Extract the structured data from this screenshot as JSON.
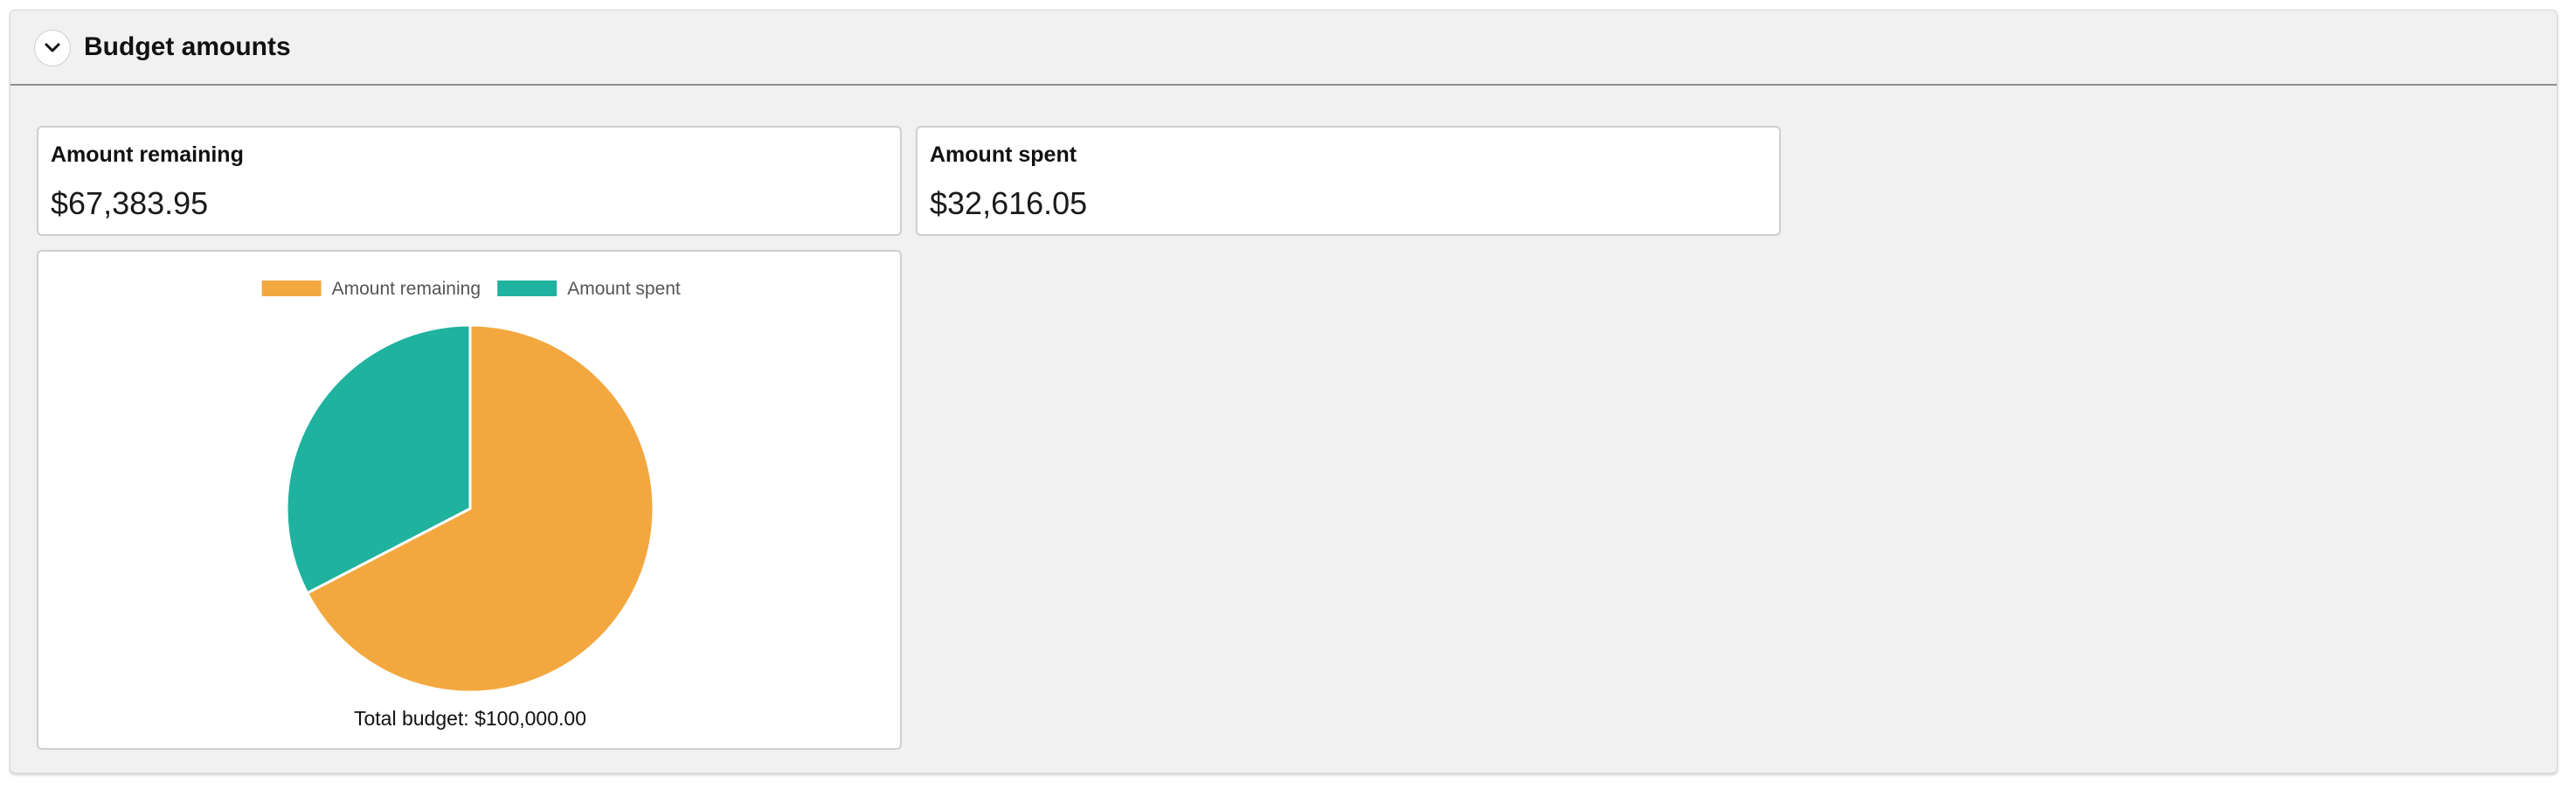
{
  "panel": {
    "title": "Budget amounts",
    "toggle_icon": "chevron-down-icon"
  },
  "cards": {
    "remaining": {
      "label": "Amount remaining",
      "value": "$67,383.95"
    },
    "spent": {
      "label": "Amount spent",
      "value": "$32,616.05"
    }
  },
  "chart_data": {
    "type": "pie",
    "title": "",
    "legend_position": "top",
    "slices": [
      {
        "label": "Amount remaining",
        "value": 67383.95,
        "color": "#F3A83F"
      },
      {
        "label": "Amount spent",
        "value": 32616.05,
        "color": "#1FB29E"
      }
    ],
    "footer": "Total budget: $100,000.00"
  }
}
